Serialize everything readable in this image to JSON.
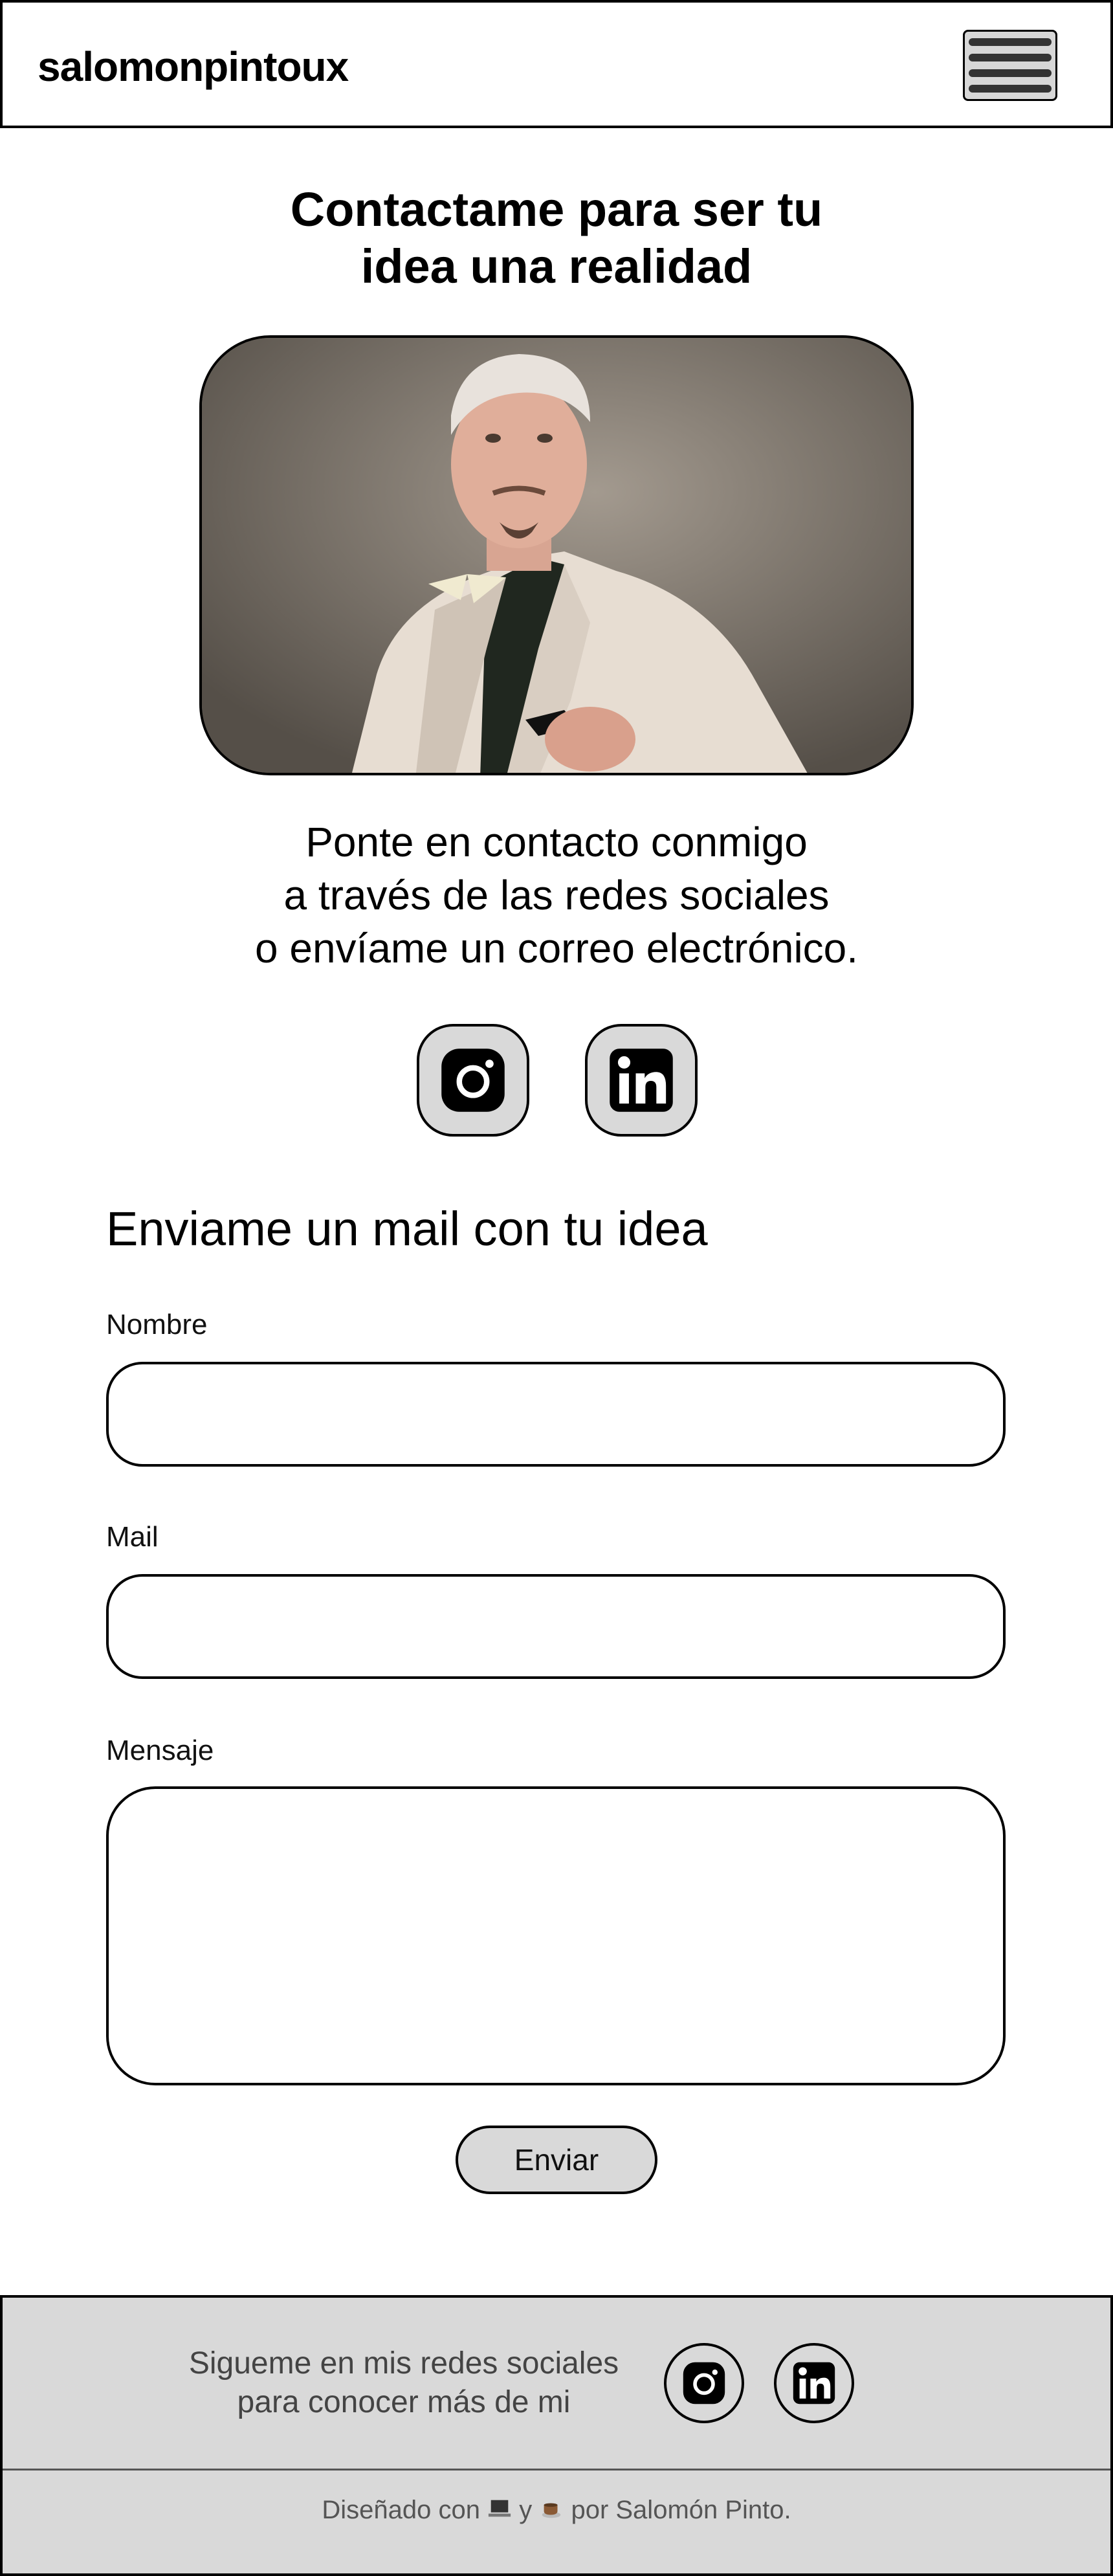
{
  "header": {
    "brand": "salomonpintoux",
    "menu_icon": "hamburger-menu-icon"
  },
  "hero": {
    "title_line1": "Contactame para ser tu",
    "title_line2": "idea una realidad",
    "photo_icon": "portrait-photo"
  },
  "contact": {
    "line1": "Ponte en contacto conmigo",
    "line2": "a través de las redes sociales",
    "line3": "o envíame un correo electrónico."
  },
  "social": {
    "instagram_icon": "instagram-icon",
    "linkedin_icon": "linkedin-icon"
  },
  "form": {
    "title": "Enviame un mail con tu idea",
    "name_label": "Nombre",
    "name_value": "",
    "mail_label": "Mail",
    "mail_value": "",
    "message_label": "Mensaje",
    "message_value": "",
    "submit_label": "Enviar"
  },
  "footer": {
    "text_line1": "Sigueme en mis redes sociales",
    "text_line2": "para conocer más de mi",
    "credit_prefix": "Diseñado con",
    "credit_icon1": "laptop-icon",
    "credit_and": "y",
    "credit_icon2": "coffee-icon",
    "credit_suffix": "por Salomón Pinto."
  },
  "colors": {
    "border": "#000000",
    "button_fill": "#d9d9d9",
    "footer_fill": "#d9d9d9",
    "text_muted": "#444444"
  }
}
